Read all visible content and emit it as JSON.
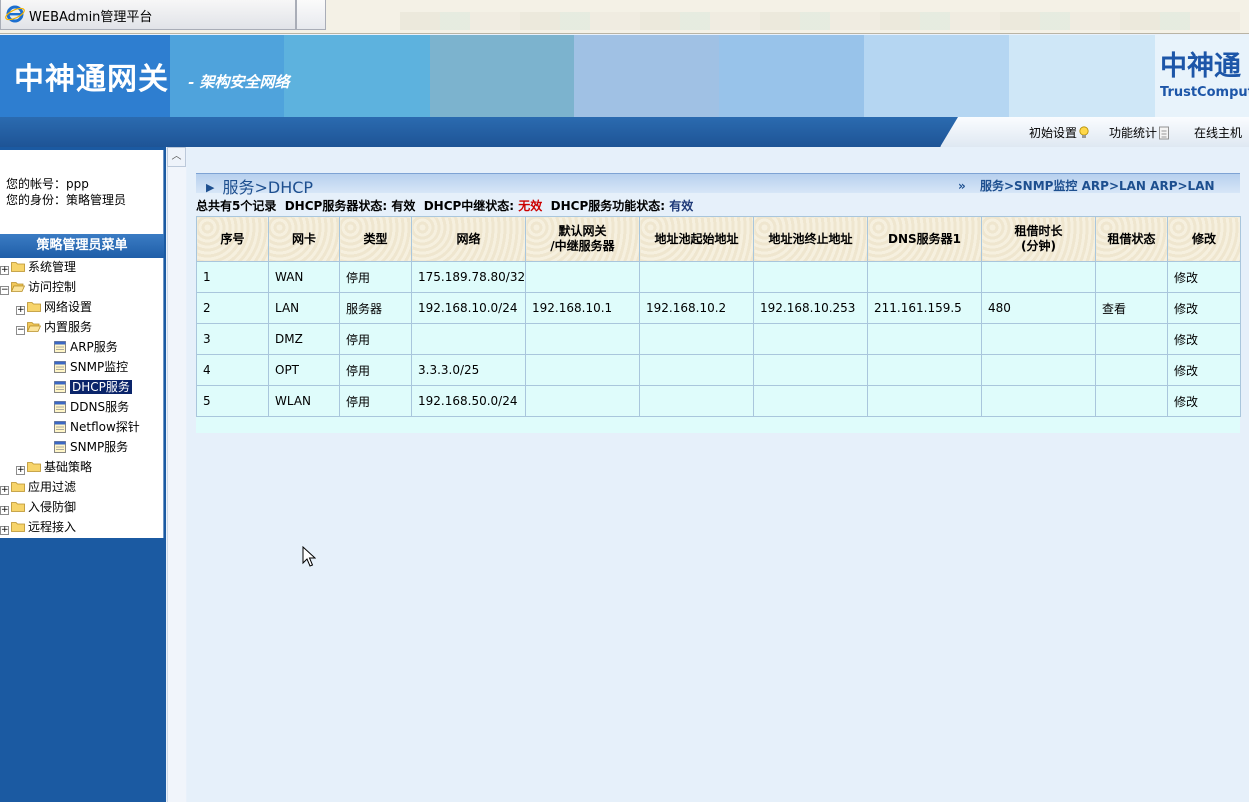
{
  "window": {
    "title": "WEBAdmin管理平台"
  },
  "header": {
    "brand_title": "中神通网关",
    "brand_subtitle": "- 架构安全网络",
    "logo_cn": "中神通",
    "logo_en": "TrustComputing",
    "colors": {
      "banner_blocks": [
        "#2e7ed0",
        "#4fa3dc",
        "#5db2de",
        "#7cb3ce",
        "#a0c1e4",
        "#98c3ea",
        "#b5d6f2",
        "#cfe7f7",
        "#e8f3fb"
      ]
    },
    "menu": [
      {
        "label": "初始设置",
        "icon": "bulb-icon"
      },
      {
        "label": "功能统计",
        "icon": "doc-icon"
      },
      {
        "label": "在线主机",
        "icon": ""
      }
    ]
  },
  "sidebar": {
    "account_line": "您的帐号：ppp",
    "role_line": "您的身份：策略管理员",
    "menu_title": "策略管理员菜单",
    "tree": [
      {
        "label": "系统管理",
        "type": "folder",
        "level": 0,
        "expander": "+"
      },
      {
        "label": "访问控制",
        "type": "folder-open",
        "level": 0,
        "expander": "-"
      },
      {
        "label": "网络设置",
        "type": "folder",
        "level": 1,
        "expander": "+"
      },
      {
        "label": "内置服务",
        "type": "folder-open",
        "level": 1,
        "expander": "-"
      },
      {
        "label": "ARP服务",
        "type": "page",
        "level": 2
      },
      {
        "label": "SNMP监控",
        "type": "page",
        "level": 2
      },
      {
        "label": "DHCP服务",
        "type": "page",
        "level": 2,
        "selected": true
      },
      {
        "label": "DDNS服务",
        "type": "page",
        "level": 2
      },
      {
        "label": "Netflow探针",
        "type": "page",
        "level": 2
      },
      {
        "label": "SNMP服务",
        "type": "page",
        "level": 2
      },
      {
        "label": "基础策略",
        "type": "folder",
        "level": 1,
        "expander": "+"
      },
      {
        "label": "应用过滤",
        "type": "folder",
        "level": 0,
        "expander": "+"
      },
      {
        "label": "入侵防御",
        "type": "folder",
        "level": 0,
        "expander": "+"
      },
      {
        "label": "远程接入",
        "type": "folder",
        "level": 0,
        "expander": "+"
      }
    ]
  },
  "main": {
    "section_title": "服务>DHCP",
    "breadcrumb": {
      "sep": "»",
      "links": [
        "服务>SNMP监控",
        "ARP>LAN",
        "ARP>LAN"
      ]
    },
    "status": {
      "total": "总共有5个记录",
      "server_label": "DHCP服务器状态:",
      "server_value": "有效",
      "relay_label": "DHCP中继状态:",
      "relay_value": "无效",
      "func_label": "DHCP服务功能状态:",
      "func_value": "有效"
    },
    "table": {
      "headers": [
        "序号",
        "网卡",
        "类型",
        "网络",
        "默认网关\n/中继服务器",
        "地址池起始地址",
        "地址池终止地址",
        "DNS服务器1",
        "租借时长\n(分钟)",
        "租借状态",
        "修改"
      ],
      "rows": [
        [
          "1",
          "WAN",
          "停用",
          "175.189.78.80/32",
          "",
          "",
          "",
          "",
          "",
          "",
          "修改"
        ],
        [
          "2",
          "LAN",
          "服务器",
          "192.168.10.0/24",
          "192.168.10.1",
          "192.168.10.2",
          "192.168.10.253",
          "211.161.159.5",
          "480",
          "查看",
          "修改"
        ],
        [
          "3",
          "DMZ",
          "停用",
          "",
          "",
          "",
          "",
          "",
          "",
          "",
          "修改"
        ],
        [
          "4",
          "OPT",
          "停用",
          "3.3.3.0/25",
          "",
          "",
          "",
          "",
          "",
          "",
          "修改"
        ],
        [
          "5",
          "WLAN",
          "停用",
          "192.168.50.0/24",
          "",
          "",
          "",
          "",
          "",
          "",
          "修改"
        ]
      ]
    }
  }
}
